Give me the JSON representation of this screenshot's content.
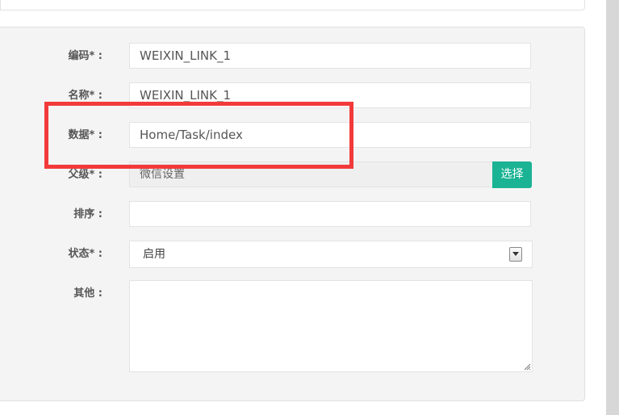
{
  "form": {
    "code": {
      "label": "编码* :",
      "value": "WEIXIN_LINK_1"
    },
    "name": {
      "label": "名称* :",
      "value": "WEIXIN_LINK_1"
    },
    "data": {
      "label": "数据* :",
      "value": "Home/Task/index"
    },
    "parent": {
      "label": "父级* :",
      "value": "微信设置",
      "button_label": "选择"
    },
    "sort": {
      "label": "排序 :",
      "value": ""
    },
    "status": {
      "label": "状态* :",
      "selected": "启用"
    },
    "other": {
      "label": "其他 :",
      "value": ""
    }
  },
  "colors": {
    "accent": "#1ab394",
    "highlight": "#f23a3a"
  }
}
